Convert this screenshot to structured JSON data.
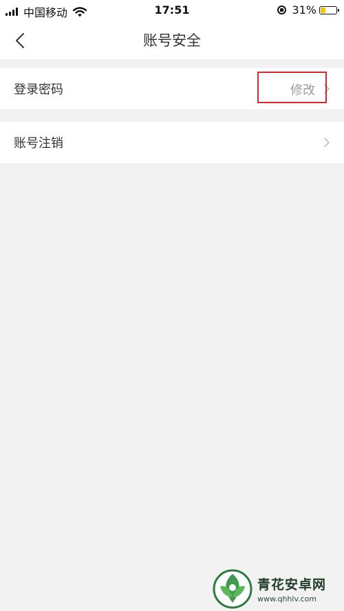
{
  "status_bar": {
    "carrier": "中国移动",
    "time": "17:51",
    "battery_percent": "31%",
    "battery_level": 0.31,
    "icons": [
      "signal-icon",
      "wifi-icon",
      "rotation-lock-icon",
      "battery-icon"
    ]
  },
  "nav": {
    "back_icon": "chevron-left-icon",
    "title": "账号安全"
  },
  "settings": {
    "rows": [
      {
        "label": "登录密码",
        "value": "修改",
        "icon": "chevron-right-icon"
      },
      {
        "label": "账号注销",
        "icon": "chevron-right-icon"
      }
    ]
  },
  "annotation": {
    "highlight_color": "#d9262c"
  },
  "watermark": {
    "name": "青花安卓网",
    "url": "www.qhhlv.com"
  }
}
